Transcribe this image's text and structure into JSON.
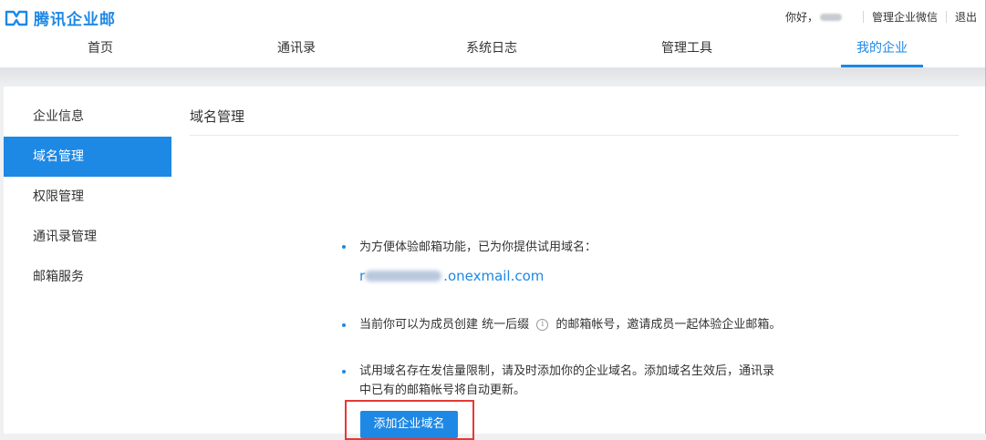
{
  "app": {
    "brand": "腾讯企业邮"
  },
  "topbar": {
    "greeting": "你好，",
    "manage_wechat": "管理企业微信",
    "logout": "退出"
  },
  "nav": {
    "items": [
      {
        "label": "首页"
      },
      {
        "label": "通讯录"
      },
      {
        "label": "系统日志"
      },
      {
        "label": "管理工具"
      },
      {
        "label": "我的企业"
      }
    ],
    "active": "我的企业"
  },
  "sidebar": {
    "items": [
      {
        "label": "企业信息"
      },
      {
        "label": "域名管理"
      },
      {
        "label": "权限管理"
      },
      {
        "label": "通讯录管理"
      },
      {
        "label": "邮箱服务"
      }
    ],
    "active": "域名管理"
  },
  "main": {
    "title": "域名管理",
    "notice1": "为方便体验邮箱功能，已为你提供试用域名：",
    "trial_domain_prefix": "r",
    "trial_domain_suffix": ".onexmail.com",
    "notice2_a": "当前你可以为成员创建 统一后缀",
    "notice2_b": "的邮箱帐号，邀请成员一起体验企业邮箱。",
    "notice3_line1": "试用域名存在发信量限制，请及时添加你的企业域名。添加域名生效后，通讯录",
    "notice3_line2": "中已有的邮箱帐号将自动更新。",
    "add_domain_button": "添加企业域名"
  },
  "colors": {
    "accent": "#1e88e5",
    "highlight_border": "#e53935"
  },
  "icons": {
    "logo": "tencent-exmail-logo-icon",
    "info": "info-icon"
  }
}
